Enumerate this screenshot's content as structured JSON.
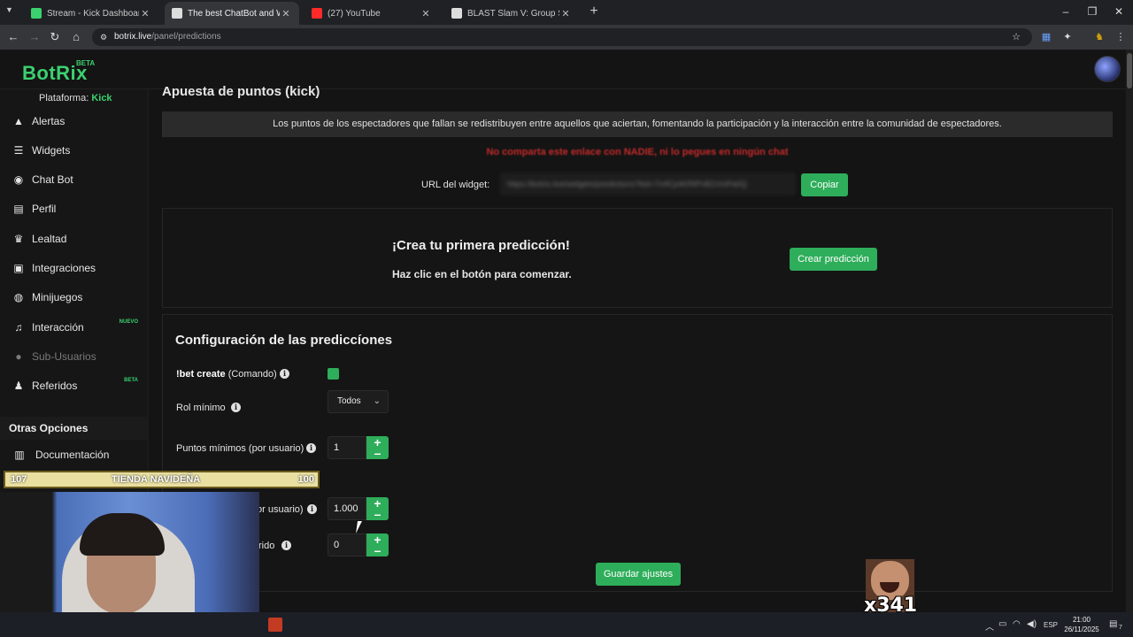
{
  "browser": {
    "tabs": [
      {
        "title": "Stream - Kick Dashboard",
        "active": false,
        "favicon_color": "#3bd16f"
      },
      {
        "title": "The best ChatBot and Widgets",
        "active": true,
        "favicon_color": "#dddddd"
      },
      {
        "title": "(27) YouTube",
        "active": false,
        "favicon_color": "#ff2b2b"
      },
      {
        "title": "BLAST Slam V: Group Stage - L",
        "active": false,
        "favicon_color": "#dddddd"
      }
    ],
    "url_host": "botrix.live",
    "url_path": "/panel/predictions"
  },
  "app": {
    "logo": "BotRix",
    "logo_badge": "BETA",
    "platform_label": "Plataforma:",
    "platform_value": "Kick"
  },
  "sidebar": {
    "items": [
      {
        "label": "Alertas",
        "icon": "warning-icon",
        "glyph": "▲"
      },
      {
        "label": "Widgets",
        "icon": "widgets-icon",
        "glyph": "☰"
      },
      {
        "label": "Chat Bot",
        "icon": "robot-icon",
        "glyph": "◉"
      },
      {
        "label": "Perfil",
        "icon": "id-card-icon",
        "glyph": "▤"
      },
      {
        "label": "Lealtad",
        "icon": "trophy-icon",
        "glyph": "♛"
      },
      {
        "label": "Integraciones",
        "icon": "integrations-icon",
        "glyph": "▣"
      },
      {
        "label": "Minijuegos",
        "icon": "gamepad-icon",
        "glyph": "◍"
      },
      {
        "label": "Interacción",
        "icon": "music-icon",
        "glyph": "♫",
        "badge": "NUEVO"
      },
      {
        "label": "Sub-Usuarios",
        "icon": "users-icon",
        "glyph": "●",
        "disabled": true
      },
      {
        "label": "Referidos",
        "icon": "referrals-icon",
        "glyph": "♟",
        "badge": "BETA"
      }
    ],
    "section_title": "Otras Opciones",
    "docs_label": "Documentación"
  },
  "main": {
    "heading": "Apuesta de puntos (kick)",
    "info": "Los puntos de los espectadores que fallan se redistribuyen entre aquellos que aciertan, fomentando la participación y la interacción entre la comunidad de espectadores.",
    "warning": "No comparta este enlace con NADIE, ni lo pegues en ningún chat",
    "widget_url_label": "URL del widget:",
    "widget_url_value": "https://botrix.live/widgets/predictions?bid=7mfCp4KRtPvB1VmPa0Q",
    "copy_button": "Copiar",
    "empty_title": "¡Crea tu primera predicción!",
    "empty_subtitle": "Haz clic en el botón para comenzar.",
    "create_button": "Crear predicción",
    "config_title": "Configuración de las prediccíones",
    "bet_create_cmd": "!bet create",
    "bet_create_suffix": " (Comando)",
    "bet_create_enabled": true,
    "min_role_label": "Rol mínimo",
    "min_role_value": "Todos",
    "min_points_label": "Puntos mínimos (por usuario)",
    "min_points_value": "1",
    "max_points_label_partial": "or usuario)",
    "max_points_value": "1.000",
    "third_label_partial": "rido",
    "third_value": "0",
    "save_button": "Guardar ajustes"
  },
  "overlay": {
    "banner_left": "107",
    "banner_center": "TIENDA NAVIDEÑA",
    "banner_right": "100",
    "meme_count": "x341"
  },
  "taskbar": {
    "lang": "ESP",
    "time": "21:00",
    "date": "26/11/2025",
    "notification_count": "7"
  }
}
